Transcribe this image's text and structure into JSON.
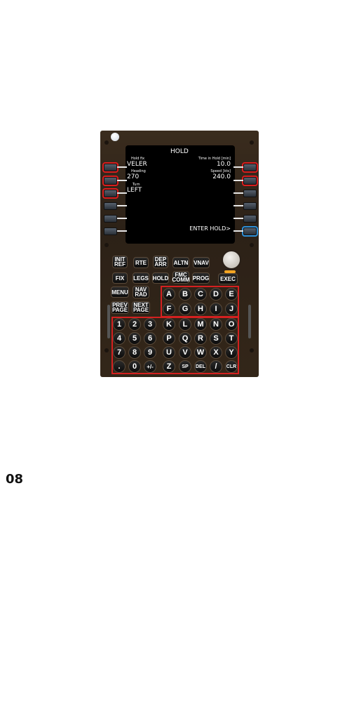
{
  "screen": {
    "title": "HOLD",
    "hold_fix_label": "Hold fix",
    "hold_fix_value": "VELER",
    "heading_label": "Heading",
    "heading_value": "270",
    "turn_label": "Turn",
    "turn_value": "LEFT",
    "time_label": "Time in Hold [min]",
    "time_value": "10.0",
    "speed_label": "Speed [kts]",
    "speed_value": "240.0",
    "enter_hold": "ENTER HOLD>"
  },
  "function_keys": {
    "init_ref": "INIT REF",
    "rte": "RTE",
    "dep_arr": "DEP ARR",
    "altn": "ALTN",
    "vnav": "VNAV",
    "fix": "FIX",
    "legs": "LEGS",
    "hold": "HOLD",
    "fmc_comm": "FMC COMM",
    "prog": "PROG",
    "exec": "EXEC",
    "menu": "MENU",
    "nav_rad": "NAV RAD",
    "prev_page": "PREV PAGE",
    "next_page": "NEXT PAGE"
  },
  "keys": {
    "row1": [
      "A",
      "B",
      "C",
      "D",
      "E"
    ],
    "row2": [
      "F",
      "G",
      "H",
      "I",
      "J"
    ],
    "row3": [
      "1",
      "2",
      "3",
      "K",
      "L",
      "M",
      "N",
      "O"
    ],
    "row4": [
      "4",
      "5",
      "6",
      "P",
      "Q",
      "R",
      "S",
      "T"
    ],
    "row5": [
      "7",
      "8",
      "9",
      "U",
      "V",
      "W",
      "X",
      "Y"
    ],
    "row6": [
      ".",
      "0",
      "+/-",
      "Z",
      "SP",
      "DEL",
      "/",
      "CLR"
    ]
  },
  "page_number": "08",
  "colors": {
    "highlight_red": "#d42020",
    "highlight_blue": "#2f8fd6",
    "exec_lamp": "#f5a623"
  }
}
